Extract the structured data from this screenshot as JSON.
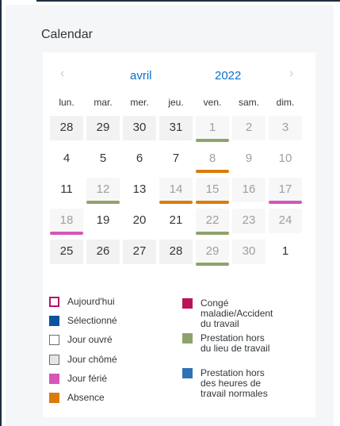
{
  "calendar": {
    "title": "Calendar",
    "month": "avril",
    "year": "2022",
    "prev_icon": "‹",
    "next_icon": "›",
    "weekdays": [
      "lun.",
      "mar.",
      "mer.",
      "jeu.",
      "ven.",
      "sam.",
      "dim."
    ],
    "days": [
      {
        "d": "28",
        "style": "off",
        "marker": ""
      },
      {
        "d": "29",
        "style": "off",
        "marker": ""
      },
      {
        "d": "30",
        "style": "off",
        "marker": ""
      },
      {
        "d": "31",
        "style": "off",
        "marker": ""
      },
      {
        "d": "1",
        "style": "mutedoff",
        "marker": "offsite"
      },
      {
        "d": "2",
        "style": "mutedoff",
        "marker": ""
      },
      {
        "d": "3",
        "style": "mutedoff",
        "marker": ""
      },
      {
        "d": "4",
        "style": "normal",
        "marker": ""
      },
      {
        "d": "5",
        "style": "normal",
        "marker": ""
      },
      {
        "d": "6",
        "style": "normal",
        "marker": ""
      },
      {
        "d": "7",
        "style": "normal",
        "marker": ""
      },
      {
        "d": "8",
        "style": "muted",
        "marker": "absence"
      },
      {
        "d": "9",
        "style": "muted",
        "marker": ""
      },
      {
        "d": "10",
        "style": "muted",
        "marker": ""
      },
      {
        "d": "11",
        "style": "normal",
        "marker": ""
      },
      {
        "d": "12",
        "style": "mutedoff",
        "marker": "offsite"
      },
      {
        "d": "13",
        "style": "normal",
        "marker": ""
      },
      {
        "d": "14",
        "style": "mutedoff",
        "marker": "absence"
      },
      {
        "d": "15",
        "style": "mutedoff",
        "marker": "absence"
      },
      {
        "d": "16",
        "style": "mutedoff",
        "marker": ""
      },
      {
        "d": "17",
        "style": "mutedoff",
        "marker": "holiday"
      },
      {
        "d": "18",
        "style": "mutedoff",
        "marker": "holiday"
      },
      {
        "d": "19",
        "style": "normal",
        "marker": ""
      },
      {
        "d": "20",
        "style": "normal",
        "marker": ""
      },
      {
        "d": "21",
        "style": "normal",
        "marker": ""
      },
      {
        "d": "22",
        "style": "mutedoff",
        "marker": "offsite"
      },
      {
        "d": "23",
        "style": "mutedoff",
        "marker": ""
      },
      {
        "d": "24",
        "style": "mutedoff",
        "marker": ""
      },
      {
        "d": "25",
        "style": "off",
        "marker": ""
      },
      {
        "d": "26",
        "style": "off",
        "marker": ""
      },
      {
        "d": "27",
        "style": "off",
        "marker": ""
      },
      {
        "d": "28",
        "style": "off",
        "marker": ""
      },
      {
        "d": "29",
        "style": "mutedoff",
        "marker": "offsite"
      },
      {
        "d": "30",
        "style": "mutedoff",
        "marker": ""
      },
      {
        "d": "1",
        "style": "normal",
        "marker": ""
      }
    ],
    "marker_colors": {
      "offsite": "#8ea36b",
      "absence": "#db7b0a",
      "holiday": "#d656b8"
    },
    "legend": [
      {
        "label": "Aujourd'hui",
        "swatch": "today",
        "fill": "#ffffff",
        "border": "#b5136d"
      },
      {
        "label": "Sélectionné",
        "swatch": "selected",
        "fill": "#0854a0",
        "border": "#0854a0"
      },
      {
        "label": "Jour ouvré",
        "swatch": "workday",
        "fill": "#ffffff",
        "border": "#6a6d70"
      },
      {
        "label": "Jour chômé",
        "swatch": "nonworking",
        "fill": "#e5e5e5",
        "border": "#6a6d70"
      },
      {
        "label": "Jour férié",
        "swatch": "holiday",
        "fill": "#d656b8",
        "border": "#d656b8"
      },
      {
        "label": "Absence",
        "swatch": "absence",
        "fill": "#db7b0a",
        "border": "#db7b0a"
      },
      {
        "label": "Congé maladie/Accident du travail",
        "lines": [
          "Congé",
          "maladie/Accident",
          "du travail"
        ],
        "swatch": "sick",
        "fill": "#b9135a",
        "border": "#b9135a"
      },
      {
        "label": "Prestation hors du lieu de travail",
        "lines": [
          "Prestation hors",
          "du lieu de travail"
        ],
        "swatch": "offsite",
        "fill": "#8ea36b",
        "border": "#8ea36b"
      },
      {
        "label": "Prestation hors des heures de travail normales",
        "lines": [
          "Prestation hors",
          "des heures de",
          "travail normales"
        ],
        "swatch": "overtime",
        "fill": "#2f72b8",
        "border": "#2f72b8"
      }
    ]
  }
}
